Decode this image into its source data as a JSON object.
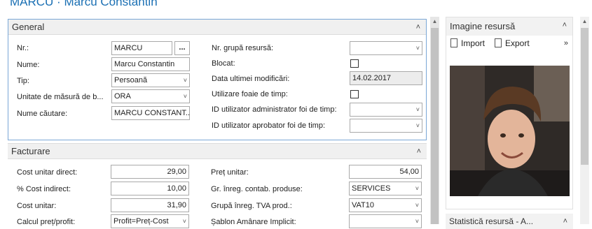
{
  "window": {
    "title": "MARCU · Marcu Constantin"
  },
  "general": {
    "header": "General",
    "fields": {
      "nr_label": "Nr.:",
      "nr_value": "MARCU",
      "nr_lookup": "...",
      "nume_label": "Nume:",
      "nume_value": "Marcu Constantin",
      "tip_label": "Tip:",
      "tip_value": "Persoană",
      "unitate_label": "Unitate de măsură de b...",
      "unitate_value": "ORA",
      "cautare_label": "Nume căutare:",
      "cautare_value": "MARCU CONSTANT...",
      "grupa_label": "Nr. grupă resursă:",
      "grupa_value": "",
      "blocat_label": "Blocat:",
      "blocat_checked": false,
      "data_label": "Data ultimei modificări:",
      "data_value": "14.02.2017",
      "foaie_label": "Utilizare foaie de timp:",
      "foaie_checked": false,
      "admin_label": "ID utilizator administrator foi de timp:",
      "admin_value": "",
      "aprobator_label": "ID utilizator aprobator foi de timp:",
      "aprobator_value": ""
    }
  },
  "facturare": {
    "header": "Facturare",
    "fields": {
      "cost_direct_label": "Cost unitar direct:",
      "cost_direct_value": "29,00",
      "cost_indirect_label": "% Cost indirect:",
      "cost_indirect_value": "10,00",
      "cost_unitar_label": "Cost unitar:",
      "cost_unitar_value": "31,90",
      "calcul_label": "Calcul preț/profit:",
      "calcul_value": "Profit=Preț-Cost",
      "pret_label": "Preț unitar:",
      "pret_value": "54,00",
      "gr_inreg_label": "Gr. înreg. contab. produse:",
      "gr_inreg_value": "SERVICES",
      "tva_label": "Grupă înreg. TVA prod.:",
      "tva_value": "VAT10",
      "sablon_label": "Șablon Amânare Implicit:",
      "sablon_value": ""
    }
  },
  "imagine": {
    "header": "Imagine resursă",
    "import_label": "Import",
    "export_label": "Export",
    "more": "»"
  },
  "statistica": {
    "header": "Statistică resursă - A..."
  },
  "icons": {
    "chevron_up": "˄",
    "chevron_down": "˅",
    "scroll_up": "▲"
  }
}
